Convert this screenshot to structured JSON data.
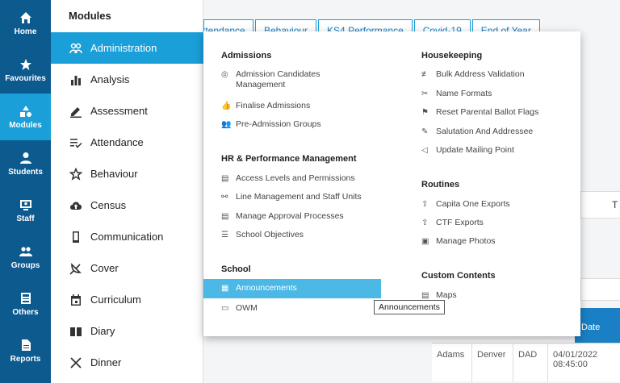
{
  "rail": [
    {
      "label": "Home",
      "icon": "home-icon",
      "active": false
    },
    {
      "label": "Favourites",
      "icon": "star-icon",
      "active": false
    },
    {
      "label": "Modules",
      "icon": "modules-icon",
      "active": true
    },
    {
      "label": "Students",
      "icon": "student-icon",
      "active": false
    },
    {
      "label": "Staff",
      "icon": "staff-icon",
      "active": false
    },
    {
      "label": "Groups",
      "icon": "groups-icon",
      "active": false
    },
    {
      "label": "Others",
      "icon": "others-icon",
      "active": false
    },
    {
      "label": "Reports",
      "icon": "reports-icon",
      "active": false
    }
  ],
  "modules": {
    "title": "Modules",
    "items": [
      {
        "label": "Administration",
        "icon": "people-icon",
        "active": true
      },
      {
        "label": "Analysis",
        "icon": "bar-chart-icon"
      },
      {
        "label": "Assessment",
        "icon": "pencil-icon"
      },
      {
        "label": "Attendance",
        "icon": "list-check-icon"
      },
      {
        "label": "Behaviour",
        "icon": "star-outline-icon"
      },
      {
        "label": "Census",
        "icon": "cloud-upload-icon"
      },
      {
        "label": "Communication",
        "icon": "phone-icon"
      },
      {
        "label": "Cover",
        "icon": "satellite-icon"
      },
      {
        "label": "Curriculum",
        "icon": "calendar-icon"
      },
      {
        "label": "Diary",
        "icon": "book-icon"
      },
      {
        "label": "Dinner",
        "icon": "cutlery-icon"
      }
    ]
  },
  "tabs": [
    "Attendance",
    "Behaviour",
    "KS4 Performance",
    "Covid-19",
    "End of Year"
  ],
  "background": {
    "col_letter": "T",
    "grid_header": "Date",
    "grid_row": [
      "Adams",
      "Denver",
      "DAD",
      "04/01/2022 08:45:00"
    ]
  },
  "dropdown": {
    "admissions": {
      "title": "Admissions",
      "items": [
        "Admission Candidates Management",
        "Finalise Admissions",
        "Pre-Admission Groups"
      ]
    },
    "hr": {
      "title": "HR & Performance Management",
      "items": [
        "Access Levels and Permissions",
        "Line Management and Staff Units",
        "Manage Approval Processes",
        "School Objectives"
      ]
    },
    "school": {
      "title": "School",
      "items": [
        "Announcements",
        "OWM"
      ]
    },
    "housekeeping": {
      "title": "Housekeeping",
      "items": [
        "Bulk Address Validation",
        "Name Formats",
        "Reset Parental Ballot Flags",
        "Salutation And Addressee",
        "Update Mailing Point"
      ]
    },
    "routines": {
      "title": "Routines",
      "items": [
        "Capita One Exports",
        "CTF Exports",
        "Manage Photos"
      ]
    },
    "custom": {
      "title": "Custom Contents",
      "items": [
        "Maps"
      ]
    }
  },
  "tooltip": "Announcements",
  "colors": {
    "rail": "#0d5a8e",
    "accent": "#1a9fd8",
    "hover": "#4cb8e6"
  }
}
